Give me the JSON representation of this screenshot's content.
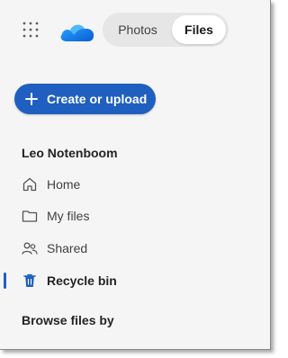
{
  "app": {
    "switcher": {
      "photos_label": "Photos",
      "files_label": "Files",
      "selected": "Files"
    }
  },
  "actions": {
    "create_label": "Create or upload"
  },
  "user": {
    "name": "Leo Notenboom"
  },
  "nav": {
    "items": [
      {
        "label": "Home",
        "icon": "home-icon"
      },
      {
        "label": "My files",
        "icon": "folder-icon"
      },
      {
        "label": "Shared",
        "icon": "people-icon"
      },
      {
        "label": "Recycle bin",
        "icon": "trash-icon",
        "active": true
      }
    ]
  },
  "browse": {
    "title": "Browse files by"
  },
  "colors": {
    "accent": "#1f5fbf",
    "panel_bg": "#f5f5f5"
  }
}
